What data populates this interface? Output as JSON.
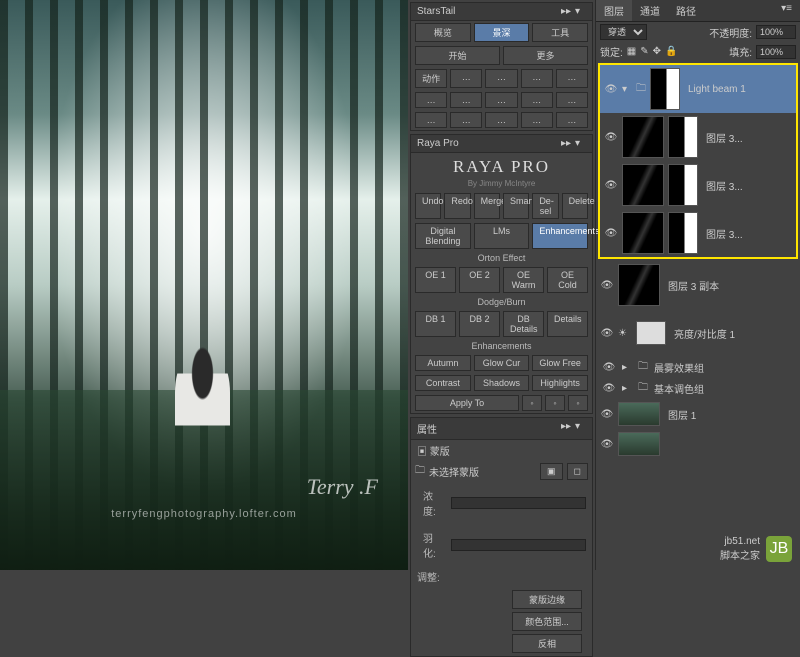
{
  "canvas": {
    "signature": "Terry .F",
    "url_text": "terryfengphotography.lofter.com"
  },
  "starstail": {
    "title": "StarsTail",
    "r1": [
      "概览",
      "景深",
      "工具"
    ],
    "r2": [
      "开始",
      "更多"
    ],
    "r3": [
      "动作",
      "…",
      "…",
      "…",
      "…"
    ],
    "r4": [
      "…",
      "…",
      "…",
      "…",
      "…"
    ],
    "r5": [
      "…",
      "…",
      "…",
      "…",
      "…"
    ]
  },
  "raya": {
    "title": "Raya Pro",
    "brand": "RAYA PRO",
    "by": "By Jimmy McIntyre",
    "row1": [
      "Undo",
      "Redo",
      "Merge",
      "Smart",
      "De-sel",
      "Delete"
    ],
    "row2": [
      "Digital Blending",
      "LMs",
      "Enhancements"
    ],
    "orton": "Orton Effect",
    "orton_btns": [
      "OE 1",
      "OE 2",
      "OE Warm",
      "OE Cold"
    ],
    "dodge": "Dodge/Burn",
    "dodge_btns": [
      "DB 1",
      "DB 2",
      "DB Details",
      "Details"
    ],
    "enh": "Enhancements",
    "enh_r1": [
      "Autumn",
      "Glow Cur",
      "Glow Free"
    ],
    "enh_r2": [
      "Contrast",
      "Shadows",
      "Highlights"
    ],
    "apply": "Apply To",
    "apply_btns": [
      "◦",
      "◦",
      "◦"
    ]
  },
  "props": {
    "title": "属性",
    "mask_label": "蒙版",
    "unselected": "未选择蒙版",
    "density": "浓度:",
    "feather": "羽化:",
    "adjust": "调整:",
    "btns": [
      "蒙版边缘",
      "颜色范围...",
      "反相"
    ]
  },
  "layers": {
    "tabs": [
      "图层",
      "通道",
      "路径"
    ],
    "blend": "穿透",
    "opacity_label": "不透明度:",
    "opacity": "100%",
    "lock_label": "锁定:",
    "fill_label": "填充:",
    "fill": "100%",
    "items": [
      {
        "name": "Light beam 1",
        "selected": true,
        "thumb": "dark",
        "mask": "sil"
      },
      {
        "name": "图层 3...",
        "thumb": "beam",
        "mask": "sil"
      },
      {
        "name": "图层 3...",
        "thumb": "beam",
        "mask": "sil"
      },
      {
        "name": "图层 3...",
        "thumb": "beam",
        "mask": "sil"
      }
    ],
    "after": [
      {
        "name": "图层 3 副本",
        "thumb": "beam"
      },
      {
        "name": "亮度/对比度 1",
        "thumb": "grad",
        "mask": "adj",
        "adj": true
      },
      {
        "group": true,
        "name": "晨雾效果组"
      },
      {
        "group": true,
        "name": "基本调色组"
      },
      {
        "name": "图层 1",
        "thumb": "img",
        "small": true
      },
      {
        "name": "",
        "thumb": "img",
        "small": true
      }
    ]
  },
  "watermark": {
    "site": "jb51.net",
    "name": "脚本之家"
  }
}
